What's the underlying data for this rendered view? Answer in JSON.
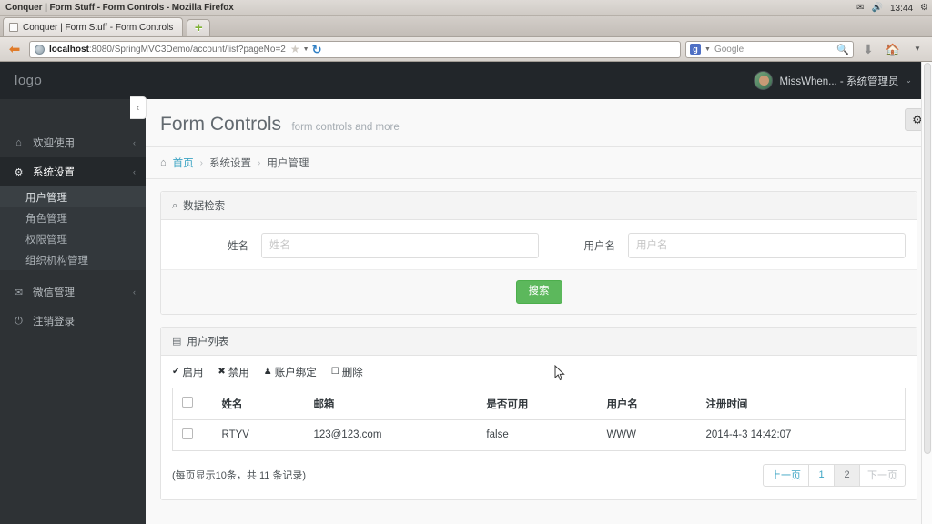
{
  "os": {
    "window_title": "Conquer | Form Stuff - Form Controls - Mozilla Firefox",
    "tray": {
      "mail_icon": "mail-icon",
      "volume_icon": "volume-mute-icon",
      "time": "13:44",
      "gear_icon": "gear-icon"
    }
  },
  "browser": {
    "tab": {
      "label": "Conquer | Form Stuff - Form Controls",
      "favicon": "page-icon"
    },
    "new_tab_glyph": "+",
    "back_glyph": "⇦",
    "url": {
      "host": "localhost",
      "path": ":8080/SpringMVC3Demo/account/list?pageNo=2"
    },
    "bookmark_star": "☆",
    "reload_glyph": "↻",
    "search": {
      "engine_initial": "g",
      "placeholder": "Google",
      "magnifier": "⌕"
    },
    "download_glyph": "⇩",
    "home_glyph": "🏠",
    "overflow_glyph": "▾"
  },
  "sidebar": {
    "brand": "logo",
    "collapse_glyph": "‹",
    "items": [
      {
        "label": "欢迎使用",
        "icon": "home-icon",
        "glyph": "⌂",
        "caret": "‹",
        "active": false
      },
      {
        "label": "系统设置",
        "icon": "cogs-icon",
        "glyph": "⚙",
        "caret": "‹",
        "active": true
      },
      {
        "label": "微信管理",
        "icon": "comments-icon",
        "glyph": "✉",
        "caret": "‹",
        "active": false
      },
      {
        "label": "注销登录",
        "icon": "power-off-icon",
        "glyph": "⏻",
        "caret": "",
        "active": false
      }
    ],
    "submenu": [
      {
        "label": "用户管理",
        "active": true
      },
      {
        "label": "角色管理",
        "active": false
      },
      {
        "label": "权限管理",
        "active": false
      },
      {
        "label": "组织机构管理",
        "active": false
      }
    ]
  },
  "header": {
    "user_name": "MissWhen... - 系统管理员",
    "avatar_icon": "avatar",
    "caret": "⌄"
  },
  "page": {
    "title": "Form Controls",
    "subtitle": "form controls and more",
    "gear_glyph": "⚙",
    "breadcrumb": {
      "home_glyph": "⌂",
      "items": [
        "首页",
        "系统设置",
        "用户管理"
      ],
      "separator": "›"
    }
  },
  "search_panel": {
    "heading": "数据检索",
    "heading_icon": "search-icon",
    "heading_glyph": "⌕",
    "fields": [
      {
        "label": "姓名",
        "placeholder": "姓名",
        "value": ""
      },
      {
        "label": "用户名",
        "placeholder": "用户名",
        "value": ""
      }
    ],
    "submit_label": "搜索"
  },
  "list_panel": {
    "heading": "用户列表",
    "heading_icon": "table-icon",
    "heading_glyph": "▤",
    "toolbar": [
      {
        "label": "启用",
        "icon": "check-icon",
        "glyph": "✔"
      },
      {
        "label": "禁用",
        "icon": "times-icon",
        "glyph": "✖"
      },
      {
        "label": "账户绑定",
        "icon": "user-icon",
        "glyph": "♟"
      },
      {
        "label": "删除",
        "icon": "trash-icon",
        "glyph": "☐"
      }
    ],
    "columns": [
      "",
      "姓名",
      "邮箱",
      "是否可用",
      "用户名",
      "注册时间"
    ],
    "rows": [
      {
        "checked": false,
        "name": "RTYV",
        "email": "123@123.com",
        "enabled": "false",
        "username": "WWW",
        "registered": "2014-4-3 14:42:07"
      }
    ],
    "record_info": "(每页显示10条，共 11 条记录)",
    "pager": [
      {
        "label": "上一页",
        "state": "normal"
      },
      {
        "label": "1",
        "state": "normal"
      },
      {
        "label": "2",
        "state": "active"
      },
      {
        "label": "下一页",
        "state": "disabled"
      }
    ]
  },
  "colors": {
    "sidebar_bg": "#2e3235",
    "sidebar_dark": "#22262a",
    "accent_green": "#5cb85c",
    "link_blue": "#3ea5c4",
    "content_bg": "#f9f9f9"
  }
}
